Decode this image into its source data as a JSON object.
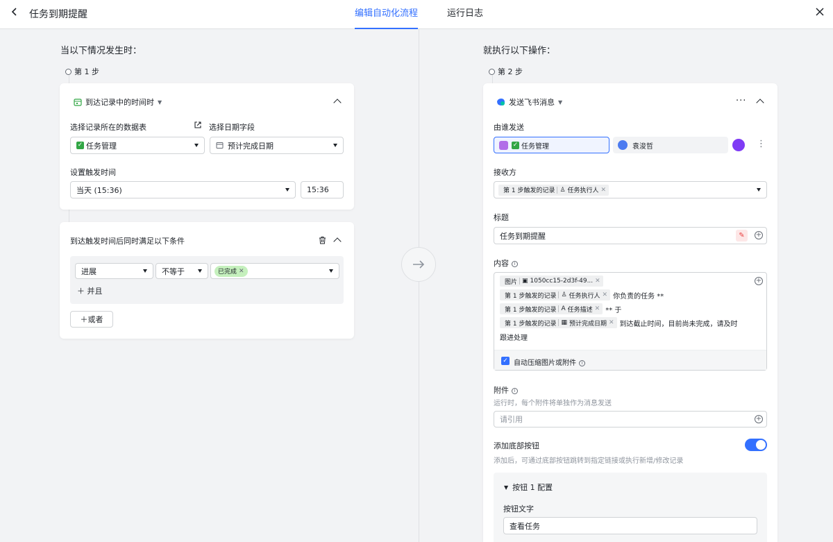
{
  "header": {
    "title": "任务到期提醒",
    "tabs": [
      {
        "label": "编辑自动化流程",
        "active": true
      },
      {
        "label": "运行日志",
        "active": false
      }
    ]
  },
  "left": {
    "section_title": "当以下情况发生时：",
    "step_label": "第 1 步",
    "trigger": {
      "type_label": "到达记录中的时间时",
      "table_label": "选择记录所在的数据表",
      "table_value": "任务管理",
      "date_field_label": "选择日期字段",
      "date_field_value": "预计完成日期",
      "trigger_time_label": "设置触发时间",
      "trigger_day_value": "当天 (15:36)",
      "trigger_time_value": "15:36"
    },
    "condition": {
      "title": "到达触发时间后同时满足以下条件",
      "field": "进展",
      "operator": "不等于",
      "value_tag": "已完成",
      "and_label": "并且",
      "or_label": "或者"
    }
  },
  "right": {
    "section_title": "就执行以下操作：",
    "step_label": "第 2 步",
    "action": {
      "type_label": "发送飞书消息",
      "sender_label": "由谁发送",
      "sender_bot": "任务管理",
      "sender_user": "袁浚哲",
      "receiver_label": "接收方",
      "receiver_tag_step": "第 1 步触发的记录",
      "receiver_tag_field": "任务执行人",
      "title_label": "标题",
      "title_value": "任务到期提醒",
      "content_label": "内容",
      "content": {
        "line1_tag_a": "图片",
        "line1_tag_b": "1050cc15-2d3f-49...",
        "step_tag": "第 1 步触发的记录",
        "line2_field": "任务执行人",
        "line2_text": "你负责的任务 **",
        "line3_field": "任务描述",
        "line3_text": "** 于",
        "line4_field": "预计完成日期",
        "line4_text": "到达截止时间，目前尚未完成，请及时",
        "line5_text": "跟进处理"
      },
      "compress_label": "自动压缩图片或附件",
      "attachment_label": "附件",
      "attachment_hint": "运行时，每个附件将单独作为消息发送",
      "attachment_placeholder": "请引用",
      "bottom_button_label": "添加底部按钮",
      "bottom_button_hint": "添加后，可通过底部按钮跳转到指定链接或执行新增/修改记录",
      "button_config_label": "按钮 1 配置",
      "button_text_label": "按钮文字",
      "button_text_value": "查看任务"
    }
  },
  "colors": {
    "accent": "#3370ff",
    "green": "#32a645"
  }
}
